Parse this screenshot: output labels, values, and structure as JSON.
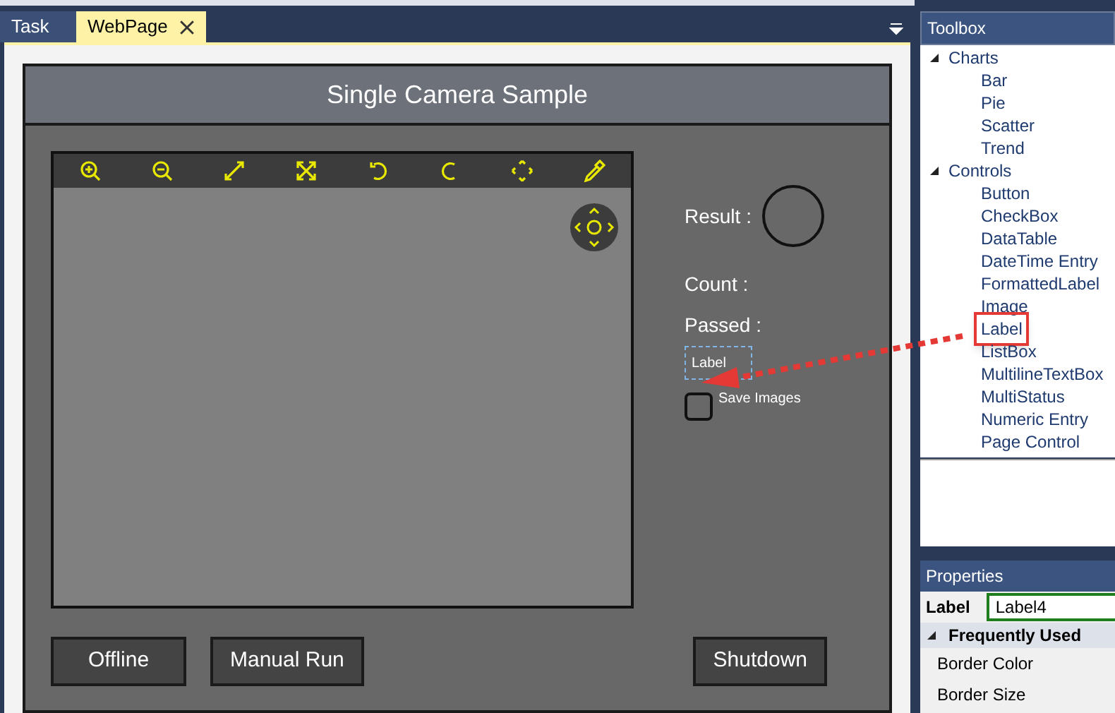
{
  "tabs": [
    {
      "label": "Task",
      "selected": false
    },
    {
      "label": "WebPage",
      "selected": true,
      "closable": true
    }
  ],
  "page": {
    "title": "Single Camera Sample",
    "result_label": "Result :",
    "count_label": "Count :",
    "passed_label": "Passed :",
    "new_label": "Label",
    "checkbox": {
      "label": "Save Images",
      "checked": false
    },
    "buttons": [
      "Offline",
      "Manual Run",
      "Shutdown"
    ]
  },
  "toolbox": {
    "title": "Toolbox",
    "groups": [
      {
        "label": "Charts",
        "expanded": true,
        "children": [
          {
            "label": "Bar"
          },
          {
            "label": "Pie"
          },
          {
            "label": "Scatter"
          },
          {
            "label": "Trend"
          }
        ]
      },
      {
        "label": "Controls",
        "expanded": true,
        "children": [
          {
            "label": "Button"
          },
          {
            "label": "CheckBox"
          },
          {
            "label": "DataTable"
          },
          {
            "label": "DateTime Entry"
          },
          {
            "label": "FormattedLabel"
          },
          {
            "label": "Image"
          },
          {
            "label": "Label",
            "highlighted": true
          },
          {
            "label": "ListBox"
          },
          {
            "label": "MultilineTextBox"
          },
          {
            "label": "MultiStatus"
          },
          {
            "label": "Numeric Entry"
          },
          {
            "label": "Page Control"
          }
        ]
      }
    ]
  },
  "properties": {
    "title": "Properties",
    "type_label": "Label",
    "name_value": "Label4",
    "section": {
      "label": "Frequently Used",
      "expanded": true
    },
    "rows": [
      "Border Color",
      "Border Size"
    ]
  }
}
